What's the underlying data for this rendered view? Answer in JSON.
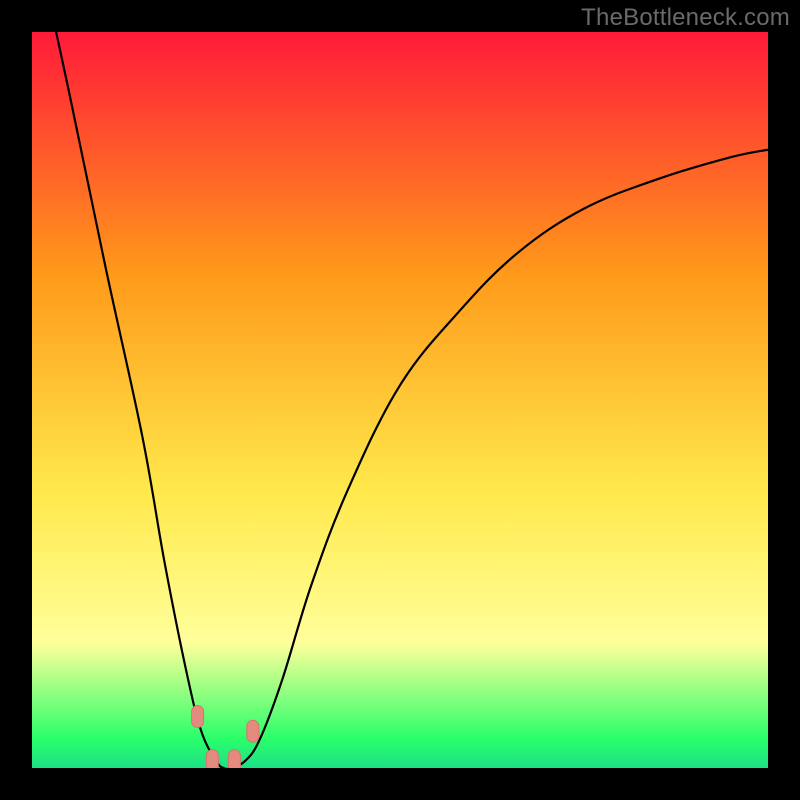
{
  "watermark": "TheBottleneck.com",
  "colors": {
    "red": "#ff1a3a",
    "orange": "#ff9a1a",
    "yellow": "#ffe84a",
    "lightyellow": "#ffff9a",
    "green": "#2aff6a",
    "green2": "#1ee086",
    "curve": "#000000",
    "marker_fill": "#e58a7e",
    "marker_stroke": "#d87468"
  },
  "chart_data": {
    "type": "line",
    "title": "",
    "xlabel": "",
    "ylabel": "",
    "xlim": [
      0,
      100
    ],
    "ylim": [
      0,
      100
    ],
    "note": "Bottleneck-style V-curve. x is relative position across plot (0-100). y is bottleneck percentage (0 = no bottleneck, green; 100 = max, red). Trough near x≈26 with y≈0.",
    "curve_points": [
      {
        "x": 0,
        "y": 115
      },
      {
        "x": 5,
        "y": 92
      },
      {
        "x": 10,
        "y": 68
      },
      {
        "x": 15,
        "y": 45
      },
      {
        "x": 18,
        "y": 28
      },
      {
        "x": 21,
        "y": 13
      },
      {
        "x": 23,
        "y": 5
      },
      {
        "x": 25,
        "y": 1
      },
      {
        "x": 26,
        "y": 0
      },
      {
        "x": 27,
        "y": 0
      },
      {
        "x": 29,
        "y": 1
      },
      {
        "x": 31,
        "y": 4
      },
      {
        "x": 34,
        "y": 12
      },
      {
        "x": 38,
        "y": 25
      },
      {
        "x": 43,
        "y": 38
      },
      {
        "x": 50,
        "y": 52
      },
      {
        "x": 58,
        "y": 62
      },
      {
        "x": 66,
        "y": 70
      },
      {
        "x": 75,
        "y": 76
      },
      {
        "x": 85,
        "y": 80
      },
      {
        "x": 95,
        "y": 83
      },
      {
        "x": 100,
        "y": 84
      }
    ],
    "markers": [
      {
        "x": 22.5,
        "y": 7
      },
      {
        "x": 24.5,
        "y": 1
      },
      {
        "x": 27.5,
        "y": 1
      },
      {
        "x": 30.0,
        "y": 5
      }
    ]
  }
}
